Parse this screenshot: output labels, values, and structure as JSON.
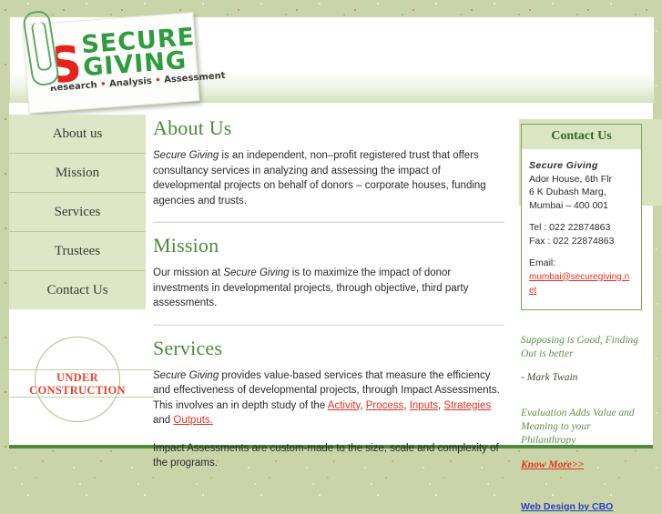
{
  "brand": {
    "mark": "S",
    "name_line1": "SECURE",
    "name_line2": "GIVING",
    "tagline_1": "Research",
    "tagline_dot": "•",
    "tagline_2": "Analysis",
    "tagline_3": "Assessment",
    "logo_green": "#2e9c3f",
    "logo_red": "#e5231b"
  },
  "nav": {
    "items": [
      {
        "label": "About us"
      },
      {
        "label": "Mission"
      },
      {
        "label": "Services"
      },
      {
        "label": "Trustees"
      },
      {
        "label": "Contact Us"
      }
    ]
  },
  "under_construction": {
    "line1": "UNDER",
    "line2": "CONSTRUCTION",
    "color": "#e6442c"
  },
  "main": {
    "about": {
      "heading": "About Us",
      "org": "Secure Giving",
      "text": " is an independent, non–profit registered trust that offers consultancy services in analyzing and assessing the impact of developmental projects on behalf of donors – corporate houses, funding agencies and trusts."
    },
    "mission": {
      "heading": "Mission",
      "text_before": "Our mission at ",
      "org": "Secure Giving",
      "text_after": " is to maximize the impact of donor investments in developmental projects, through objective, third party assessments."
    },
    "services": {
      "heading": "Services",
      "org": "Secure Giving",
      "text_before": " provides value-based services that measure the efficiency and effectiveness of developmental projects, through Impact Assessments. This involves an in depth study of the ",
      "links": [
        "Activity",
        "Process",
        "Inputs",
        "Strategies",
        "Outputs."
      ],
      "conjunction": " and ",
      "paragraph2": "Impact Assessments are custom-made to the size, scale and complexity of the programs."
    }
  },
  "contact": {
    "heading": "Contact Us",
    "org": "Secure Giving",
    "address_lines": [
      "Ador House, 6th Flr",
      "6 K Dubash Marg,",
      "Mumbai – 400 001"
    ],
    "tel": "Tel : 022 22874863",
    "fax": "Fax : 022 22874863",
    "email_label": "Email:",
    "email": "mumbai@securegiving.net"
  },
  "quote": {
    "text": "Supposing is Good, Finding Out is better",
    "attribution": "- Mark Twain"
  },
  "tagline_block": {
    "text": "Evaluation Adds Value and Meaning to your Philanthropy",
    "link": "Know More>>"
  },
  "footer": {
    "credit": "Web Design by CBO"
  }
}
